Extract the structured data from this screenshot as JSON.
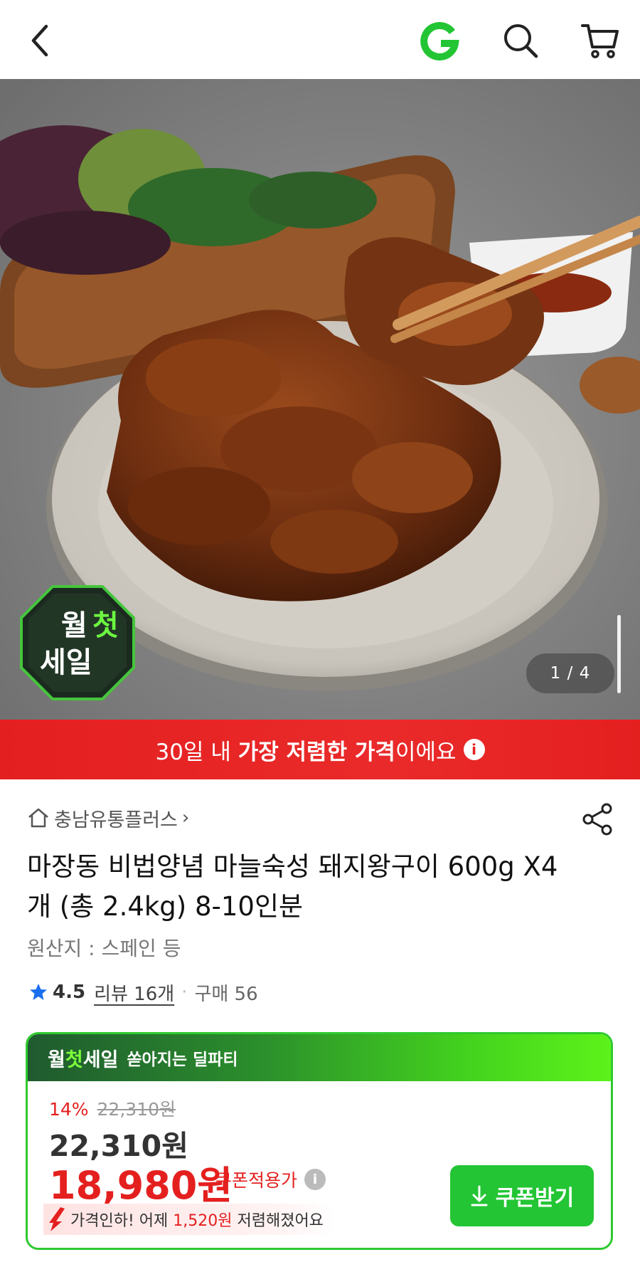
{
  "header": {
    "back_icon": "chevron-left-icon",
    "brand_icon": "gmarket-g-logo",
    "search_icon": "search-icon",
    "cart_icon": "cart-icon"
  },
  "hero": {
    "counter": "1 / 4",
    "badge_lines": [
      "월",
      "첫",
      "세일"
    ]
  },
  "banner": {
    "prefix": "30일 내 ",
    "bold": "가장 저렴한 가격",
    "suffix": "이에요",
    "info": "i"
  },
  "product": {
    "seller": "충남유통플러스",
    "seller_chevron": "›",
    "title": "마장동 비법양념 마늘숙성 돼지왕구이 600g X4개 (총 2.4kg) 8-10인분",
    "origin": "원산지 : 스페인 등",
    "rating": "4.5",
    "reviews": "리뷰 16개",
    "separator": "·",
    "purchases": "구매 56"
  },
  "deal": {
    "head_brand_1": "월",
    "head_brand_2": "첫",
    "head_brand_3": "세일",
    "head_sub": "쏟아지는 딜파티",
    "discount": "14%",
    "strike_price": "22,310원",
    "original_price": "22,310원",
    "final_price": "18,980원",
    "coupon_label": "쿠폰적용가",
    "coupon_info": "i",
    "drop_text_1": "가격인하! 어제 ",
    "drop_amount": "1,520원",
    "drop_text_2": " 저렴해졌어요",
    "coupon_button": "쿠폰받기"
  },
  "colors": {
    "accent_red": "#e4201f",
    "accent_green": "#23c534"
  }
}
